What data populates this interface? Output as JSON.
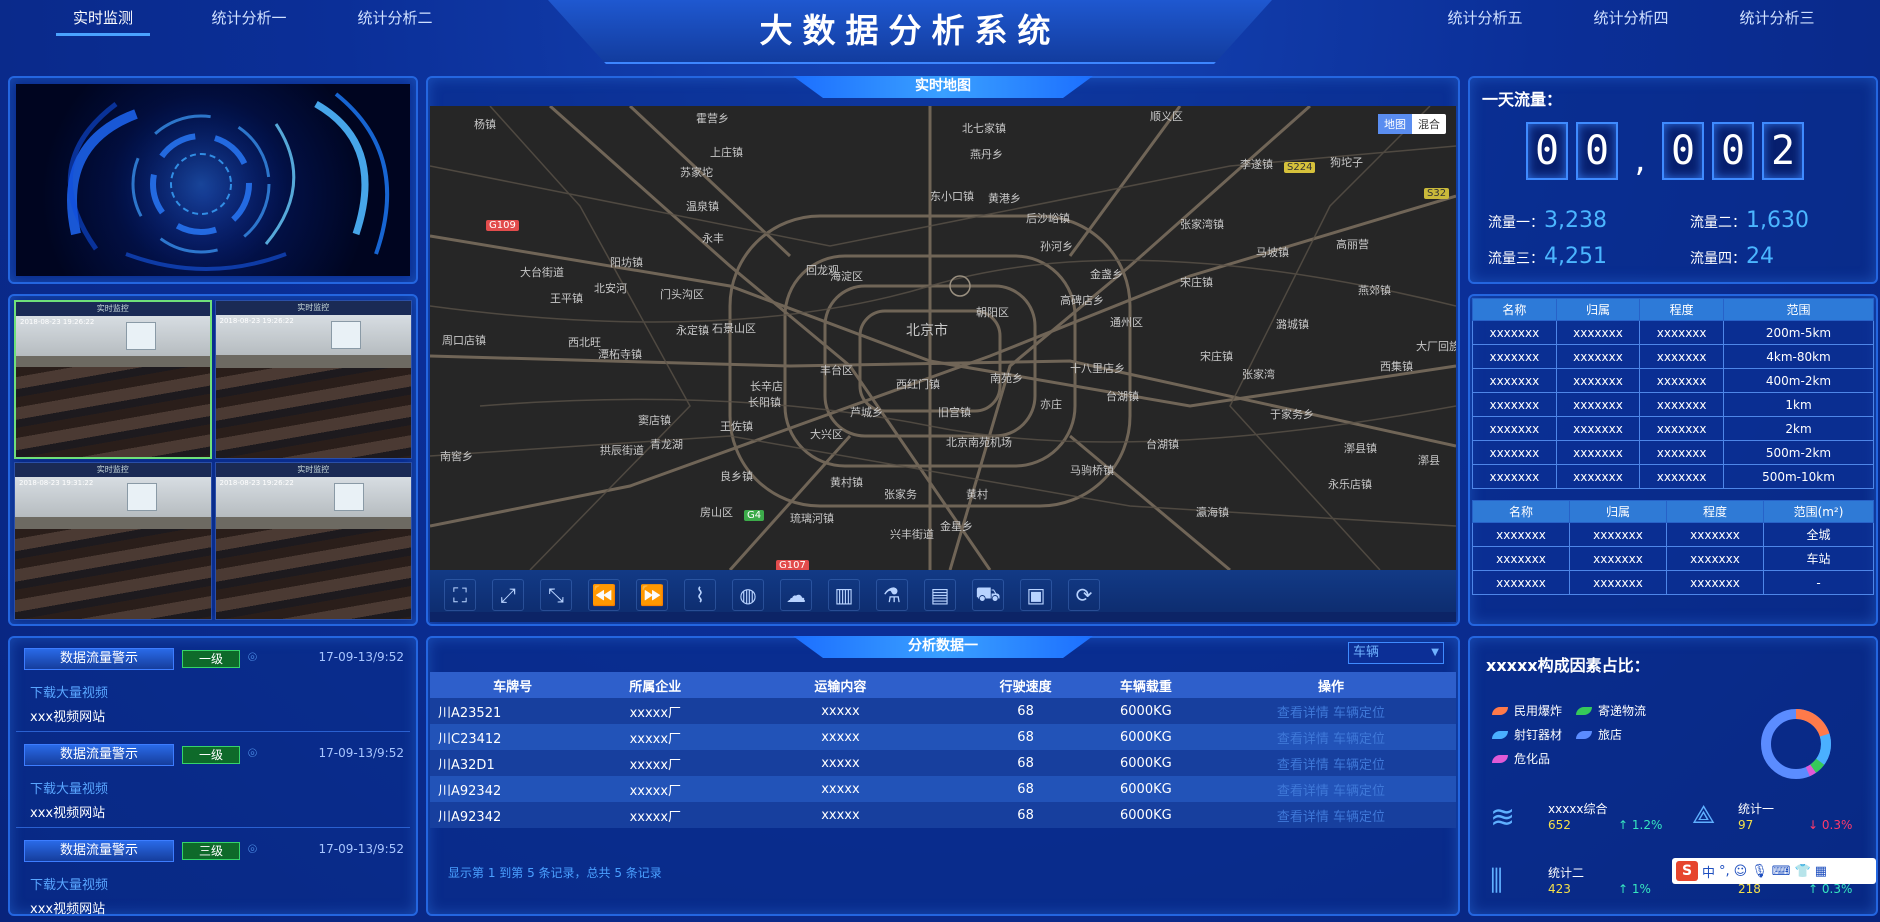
{
  "nav": {
    "left": [
      "实时监测",
      "统计分析一",
      "统计分析二"
    ],
    "right": [
      "统计分析五",
      "统计分析四",
      "统计分析三"
    ]
  },
  "title": "大数据分析系统",
  "map": {
    "title": "实时地图",
    "toggle": [
      "地图",
      "混合"
    ],
    "labels": [
      "杨镇",
      "顺义区",
      "北七家镇",
      "燕丹乡",
      "霍营乡",
      "上庄镇",
      "苏家坨",
      "温泉镇",
      "东小口镇",
      "黄港乡",
      "后沙峪镇",
      "李遂镇",
      "张家湾镇",
      "狗坨子",
      "孙河乡",
      "金盏乡",
      "高丽营",
      "马坡镇",
      "阳坊镇",
      "北安河",
      "西北旺",
      "永丰",
      "回龙观",
      "王平镇",
      "大台街道",
      "门头沟区",
      "北京市",
      "海淀区",
      "朝阳区",
      "石景山区",
      "丰台区",
      "通州区",
      "永定镇",
      "长辛店",
      "宋庄镇",
      "潭柘寺镇",
      "王佐镇",
      "长阳镇",
      "良乡镇",
      "大兴区",
      "黄村镇",
      "西红门镇",
      "北京南苑机场",
      "旧宫镇",
      "亦庄",
      "马驹桥镇",
      "台湖镇",
      "于家务乡",
      "永乐店镇",
      "台湖镇",
      "漷县镇",
      "周口店镇",
      "窦店镇",
      "琉璃河镇",
      "张家务",
      "南窖乡",
      "房山区",
      "青龙湖",
      "拱辰街道",
      "大厂回族自治县",
      "燕郊镇",
      "西集镇",
      "潞城镇",
      "漷县",
      "宋庄镇",
      "高碑店乡",
      "十八里店乡",
      "南苑乡",
      "金星乡",
      "芦城乡",
      "黄村",
      "兴丰街道",
      "张家湾",
      "瀛海镇"
    ],
    "roads": [
      "G109",
      "S224",
      "S32",
      "G4",
      "G107"
    ]
  },
  "tools": [
    "fullscreen-icon",
    "expand-icon",
    "shrink-icon",
    "rewind-icon",
    "forward-icon",
    "route-icon",
    "globe-icon",
    "cloud-icon",
    "building-icon",
    "flask-icon",
    "city-icon",
    "truck-icon",
    "chart-window-icon",
    "refresh-icon"
  ],
  "alerts": [
    {
      "title": "数据流量警示",
      "level": "一级",
      "time": "17-09-13/9:52",
      "link": "下载大量视频",
      "site": "xxx视频网站"
    },
    {
      "title": "数据流量警示",
      "level": "一级",
      "time": "17-09-13/9:52",
      "link": "下载大量视频",
      "site": "xxx视频网站"
    },
    {
      "title": "数据流量警示",
      "level": "三级",
      "time": "17-09-13/9:52",
      "link": "下载大量视频",
      "site": "xxx视频网站"
    }
  ],
  "cams": [
    {
      "title": "实时监控",
      "ts": "2018-08-23 19:26:22"
    },
    {
      "title": "实时监控",
      "ts": "2018-08-23 19:26:22"
    },
    {
      "title": "实时监控",
      "ts": "2018-08-23 19:31:22"
    },
    {
      "title": "实时监控",
      "ts": "2018-08-23 19:26:22"
    }
  ],
  "flow": {
    "title": "一天流量：",
    "digits": [
      "0",
      "0",
      ",",
      "0",
      "0",
      "2"
    ],
    "stats": [
      {
        "label": "流量一：",
        "value": "3,238"
      },
      {
        "label": "流量二：",
        "value": "1,630"
      },
      {
        "label": "流量三：",
        "value": "4,251"
      },
      {
        "label": "流量四：",
        "value": "24"
      }
    ]
  },
  "table1": {
    "headers": [
      "名称",
      "归属",
      "程度",
      "范围"
    ],
    "rows": [
      [
        "xxxxxxx",
        "xxxxxxx",
        "xxxxxxx",
        "200m-5km"
      ],
      [
        "xxxxxxx",
        "xxxxxxx",
        "xxxxxxx",
        "4km-80km"
      ],
      [
        "xxxxxxx",
        "xxxxxxx",
        "xxxxxxx",
        "400m-2km"
      ],
      [
        "xxxxxxx",
        "xxxxxxx",
        "xxxxxxx",
        "1km"
      ],
      [
        "xxxxxxx",
        "xxxxxxx",
        "xxxxxxx",
        "2km"
      ],
      [
        "xxxxxxx",
        "xxxxxxx",
        "xxxxxxx",
        "500m-2km"
      ],
      [
        "xxxxxxx",
        "xxxxxxx",
        "xxxxxxx",
        "500m-10km"
      ]
    ]
  },
  "table2": {
    "headers": [
      "名称",
      "归属",
      "程度",
      "范围(m²)"
    ],
    "rows": [
      [
        "xxxxxxx",
        "xxxxxxx",
        "xxxxxxx",
        "全城"
      ],
      [
        "xxxxxxx",
        "xxxxxxx",
        "xxxxxxx",
        "车站"
      ],
      [
        "xxxxxxx",
        "xxxxxxx",
        "xxxxxxx",
        "-"
      ]
    ]
  },
  "analysis": {
    "title": "分析数据一",
    "select": "车辆",
    "headers": [
      "车牌号",
      "所属企业",
      "运输内容",
      "行驶速度",
      "车辆载重",
      "操作"
    ],
    "rows": [
      [
        "川A23521",
        "xxxxx厂",
        "xxxxx",
        "68",
        "6000KG",
        "查看详情 车辆定位"
      ],
      [
        "川C23412",
        "xxxxx厂",
        "xxxxx",
        "68",
        "6000KG",
        "查看详情 车辆定位"
      ],
      [
        "川A32D1",
        "xxxxx厂",
        "xxxxx",
        "68",
        "6000KG",
        "查看详情 车辆定位"
      ],
      [
        "川A92342",
        "xxxxx厂",
        "xxxxx",
        "68",
        "6000KG",
        "查看详情 车辆定位"
      ],
      [
        "川A92342",
        "xxxxx厂",
        "xxxxx",
        "68",
        "6000KG",
        "查看详情 车辆定位"
      ]
    ],
    "footer": "显示第 1 到第 5 条记录，总共 5 条记录"
  },
  "factor": {
    "title": "xxxxx构成因素占比：",
    "legend": [
      {
        "name": "民用爆炸",
        "color": "#ff7a4a"
      },
      {
        "name": "寄递物流",
        "color": "#36c95a"
      },
      {
        "name": "射钉器材",
        "color": "#4ab0ff"
      },
      {
        "name": "旅店",
        "color": "#5b8cff"
      },
      {
        "name": "危化品",
        "color": "#e05ad6"
      }
    ],
    "kpis": [
      {
        "name": "xxxxx综合",
        "value": "652",
        "change": "1.2%",
        "dir": "up"
      },
      {
        "name": "统计一",
        "value": "97",
        "change": "0.3%",
        "dir": "down"
      },
      {
        "name": "统计二",
        "value": "423",
        "change": "1%",
        "dir": "up"
      },
      {
        "name": "",
        "value": "218",
        "change": "0.3%",
        "dir": "up"
      }
    ]
  },
  "ime": {
    "label": "中"
  }
}
